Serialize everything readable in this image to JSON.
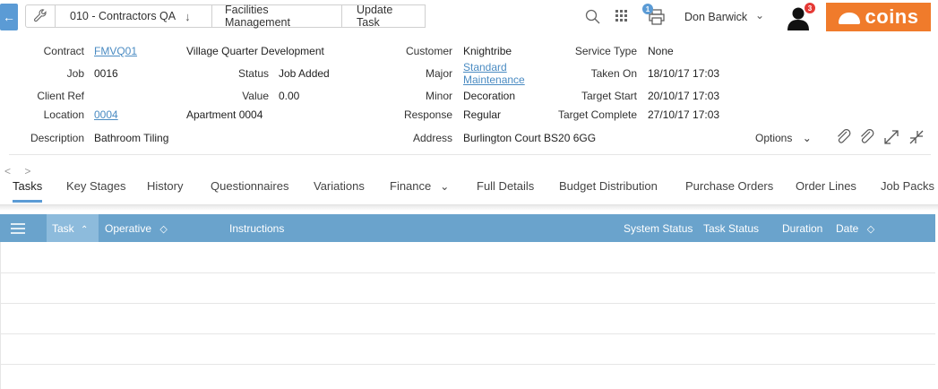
{
  "topbar": {
    "breadcrumbs": [
      {
        "label": "010 - Contractors QA",
        "has_dropdown": true
      },
      {
        "label": "Facilities Management"
      },
      {
        "label": "Update Task"
      }
    ],
    "print_badge": "1",
    "user_name": "Don Barwick",
    "notification_badge": "3",
    "brand": "coins",
    "brand_color": "#f07b2b",
    "icons": [
      "back-arrow-icon",
      "wrench-icon",
      "search-icon",
      "apps-grid-icon",
      "printer-icon",
      "user-icon"
    ]
  },
  "details": {
    "contract_label": "Contract",
    "contract_code": "FMVQ01",
    "contract_name": "Village Quarter Development",
    "job_label": "Job",
    "job_value": "0016",
    "status_label": "Status",
    "status_value": "Job Added",
    "client_ref_label": "Client Ref",
    "value_label": "Value",
    "value_value": "0.00",
    "location_label": "Location",
    "location_code": "0004",
    "location_name": "Apartment 0004",
    "description_label": "Description",
    "description_value": "Bathroom Tiling",
    "customer_label": "Customer",
    "customer_value": "Knightribe",
    "major_label": "Major",
    "major_value_1": "Standard",
    "major_value_2": "Maintenance",
    "minor_label": "Minor",
    "minor_value": "Decoration",
    "response_label": "Response",
    "response_value": "Regular",
    "address_label": "Address",
    "address_value": "Burlington Court BS20 6GG",
    "service_type_label": "Service Type",
    "service_type_value": "None",
    "taken_on_label": "Taken On",
    "taken_on_value": "18/10/17 17:03",
    "target_start_label": "Target Start",
    "target_start_value": "20/10/17 17:03",
    "target_complete_label": "Target Complete",
    "target_complete_value": "27/10/17 17:03",
    "options_label": "Options"
  },
  "tabs_nav_arrows": "< >",
  "tabs": [
    {
      "label": "Tasks",
      "active": true
    },
    {
      "label": "Key Stages"
    },
    {
      "label": "History"
    },
    {
      "label": "Questionnaires"
    },
    {
      "label": "Variations"
    },
    {
      "label": "Finance",
      "has_dropdown": true
    },
    {
      "label": "Full Details"
    },
    {
      "label": "Budget Distribution"
    },
    {
      "label": "Purchase Orders"
    },
    {
      "label": "Order Lines"
    },
    {
      "label": "Job Packs"
    }
  ],
  "grid": {
    "header_color": "#6aa3cc",
    "columns": [
      {
        "label": "Task",
        "sort": "asc"
      },
      {
        "label": "Operative",
        "sortable": true
      },
      {
        "label": "Instructions"
      },
      {
        "label": "System Status"
      },
      {
        "label": "Task Status"
      },
      {
        "label": "Duration"
      },
      {
        "label": "Date",
        "sortable": true
      }
    ],
    "rows": []
  }
}
